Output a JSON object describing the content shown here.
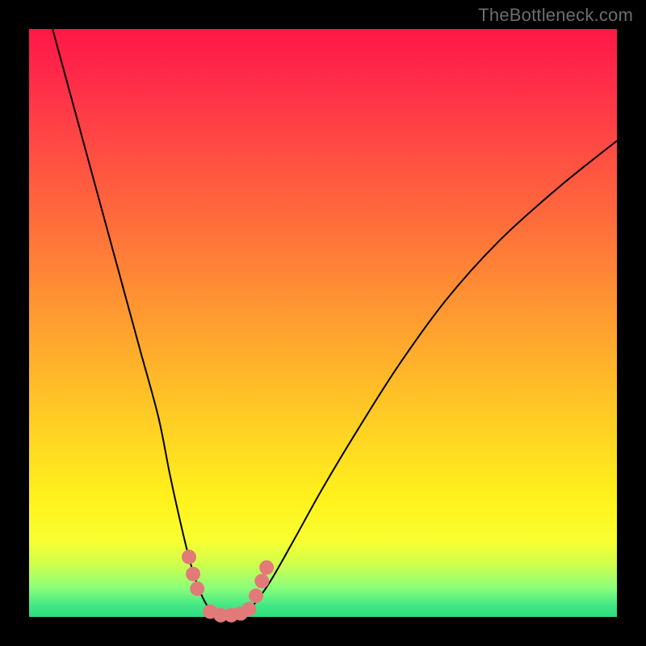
{
  "watermark": {
    "text": "TheBottleneck.com"
  },
  "chart_data": {
    "type": "line",
    "title": "",
    "xlabel": "",
    "ylabel": "",
    "xlim": [
      0,
      100
    ],
    "ylim": [
      0,
      100
    ],
    "series": [
      {
        "name": "left-branch",
        "x": [
          4,
          7,
          10,
          13,
          16,
          19,
          22,
          24,
          26,
          27.5,
          29,
          30.5,
          32
        ],
        "values": [
          100,
          89,
          78,
          67,
          56,
          45,
          34,
          24,
          15,
          9,
          4.5,
          1.6,
          0
        ]
      },
      {
        "name": "right-branch",
        "x": [
          36,
          38,
          41,
          45,
          50,
          56,
          63,
          71,
          80,
          90,
          100
        ],
        "values": [
          0,
          1.8,
          6,
          13,
          22,
          32,
          43,
          54,
          64,
          73,
          81
        ]
      },
      {
        "name": "valley-floor",
        "x": [
          32,
          33.5,
          34.5,
          36
        ],
        "values": [
          0,
          0,
          0,
          0
        ]
      }
    ],
    "markers": [
      {
        "series": "left-branch",
        "x": 27.2,
        "y": 10.2
      },
      {
        "series": "left-branch",
        "x": 27.9,
        "y": 7.3
      },
      {
        "series": "left-branch",
        "x": 28.6,
        "y": 4.8
      },
      {
        "series": "valley-floor",
        "x": 30.8,
        "y": 0.9
      },
      {
        "series": "valley-floor",
        "x": 32.6,
        "y": 0.3
      },
      {
        "series": "valley-floor",
        "x": 34.4,
        "y": 0.3
      },
      {
        "series": "valley-floor",
        "x": 36.0,
        "y": 0.6
      },
      {
        "series": "valley-floor",
        "x": 37.4,
        "y": 1.3
      },
      {
        "series": "right-branch",
        "x": 38.6,
        "y": 3.6
      },
      {
        "series": "right-branch",
        "x": 39.6,
        "y": 6.1
      },
      {
        "series": "right-branch",
        "x": 40.4,
        "y": 8.4
      }
    ],
    "colors": {
      "curve": "#000000",
      "marker": "#e27a7a"
    }
  }
}
